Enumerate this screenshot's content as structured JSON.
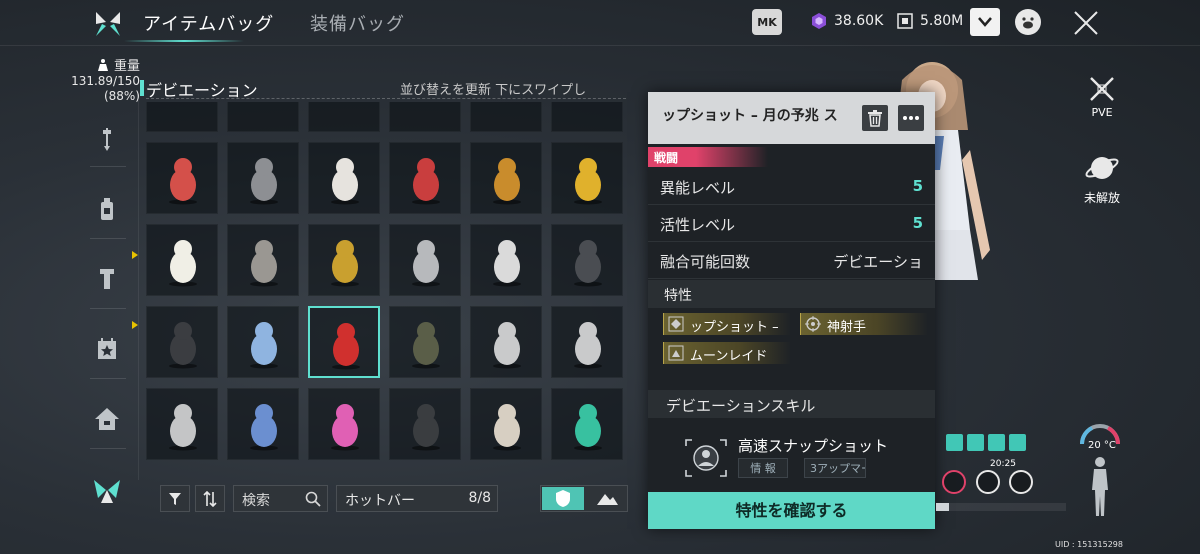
{
  "header": {
    "tabs": [
      {
        "label": "アイテムバッグ",
        "active": true
      },
      {
        "label": "装備バッグ",
        "active": false
      }
    ],
    "currency_badge": "MK",
    "currencies": [
      {
        "icon": "crystal-icon",
        "value": "38.60K"
      },
      {
        "icon": "coin-icon",
        "value": "5.80M"
      }
    ]
  },
  "sidebar": {
    "weight_label": "重量",
    "weight_value": "131.89/150",
    "weight_percent": "(88%)",
    "items": [
      {
        "icon": "wrench-icon"
      },
      {
        "icon": "bottle-icon"
      },
      {
        "icon": "bolt-icon"
      },
      {
        "icon": "calendar-star-icon"
      },
      {
        "icon": "house-icon"
      },
      {
        "icon": "deviation-icon",
        "active": true
      }
    ]
  },
  "grid": {
    "section_title": "デビエーション",
    "sort_text": "並び替えを更新 下にスワイプし",
    "selected_index": 14,
    "cells": [
      {
        "name": "red-dragon"
      },
      {
        "name": "pyramid"
      },
      {
        "name": "white-owl"
      },
      {
        "name": "red-bird"
      },
      {
        "name": "scarecrow"
      },
      {
        "name": "golden-snail"
      },
      {
        "name": "feather-egg"
      },
      {
        "name": "stone-owl"
      },
      {
        "name": "golden-toad"
      },
      {
        "name": "grey-cat"
      },
      {
        "name": "white-rabbit"
      },
      {
        "name": "dark-wolf"
      },
      {
        "name": "black-hand"
      },
      {
        "name": "blue-camera"
      },
      {
        "name": "red-camera"
      },
      {
        "name": "vine-orb"
      },
      {
        "name": "white-beast"
      },
      {
        "name": "white-beast"
      },
      {
        "name": "white-goat"
      },
      {
        "name": "blue-loop"
      },
      {
        "name": "pink-blob"
      },
      {
        "name": "orca"
      },
      {
        "name": "deer-bear"
      },
      {
        "name": "teal-dino"
      }
    ]
  },
  "toolbar": {
    "search_label": "検索",
    "hotbar_label": "ホットバー",
    "hotbar_count": "8/8"
  },
  "detail": {
    "title": "ップショット – 月の予兆 ス",
    "category": "戦闘",
    "stats": [
      {
        "label": "異能レベル",
        "value": "5"
      },
      {
        "label": "活性レベル",
        "value": "5"
      },
      {
        "label": "融合可能回数",
        "value": "デビエーショ"
      }
    ],
    "traits_header": "特性",
    "traits": [
      {
        "label": "ップショット –",
        "icon": "diamond-icon"
      },
      {
        "label": "神射手",
        "icon": "crosshair-icon"
      },
      {
        "label": "ムーンレイド",
        "icon": "moon-icon"
      }
    ],
    "skill_header": "デビエーションスキル",
    "skill_name": "高速スナップショット",
    "skill_tags": [
      "情 報",
      "3アップマー"
    ],
    "confirm_label": "特性を確認する"
  },
  "right": {
    "pve_label": "PVE",
    "unlock_label": "未解放",
    "time": "20:25",
    "temperature": "20 °C",
    "hp_fraction": 0.1,
    "uid": "UID : 151315298"
  },
  "colors": {
    "accent": "#5fe0d0",
    "combat": "#e0426a",
    "trait_gold": "#b9a54a"
  }
}
